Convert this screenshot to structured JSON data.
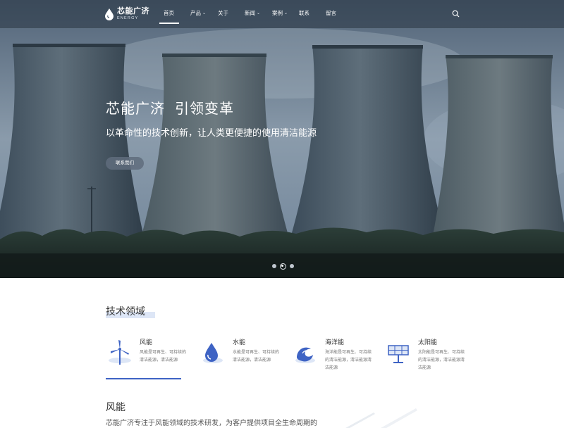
{
  "nav": {
    "logo_cn": "芯能广济",
    "logo_en": "ENERGY",
    "items": [
      {
        "label": "首页",
        "has_dropdown": false
      },
      {
        "label": "产品",
        "has_dropdown": true
      },
      {
        "label": "关于",
        "has_dropdown": false
      },
      {
        "label": "新闻",
        "has_dropdown": true
      },
      {
        "label": "案例",
        "has_dropdown": true
      },
      {
        "label": "联系",
        "has_dropdown": false
      },
      {
        "label": "留言",
        "has_dropdown": false
      }
    ],
    "active_index": 0,
    "search_icon": "search-icon"
  },
  "hero": {
    "title_part1": "芯能广济",
    "title_part2": "引领变革",
    "subtitle": "以革命性的技术创新，让人类更便捷的使用清洁能源",
    "button_label": "联系我们",
    "slides_count": 3,
    "active_slide": 1
  },
  "tech_section": {
    "title": "技术领域",
    "items": [
      {
        "name": "风能",
        "desc": "风能是可再生、可持续的清洁能源，清洁能源",
        "icon": "wind-turbine-icon"
      },
      {
        "name": "水能",
        "desc": "水能是可再生、可持续的清洁能源，清洁能源",
        "icon": "water-drop-icon"
      },
      {
        "name": "海洋能",
        "desc": "海洋能是可再生、可持续的清洁能源，清洁能源清洁能源",
        "icon": "wave-icon"
      },
      {
        "name": "太阳能",
        "desc": "太阳能是可再生、可持续的清洁能源，清洁能源清洁能源",
        "icon": "solar-panel-icon"
      }
    ],
    "active_index": 0
  },
  "feature": {
    "title": "风能",
    "text": "芯能广济专注于风能领域的技术研发，为客户提供项目全生命周期的"
  },
  "colors": {
    "accent": "#3e63c4",
    "accent_light": "#dde6f6",
    "nav_bg": "#283442"
  }
}
